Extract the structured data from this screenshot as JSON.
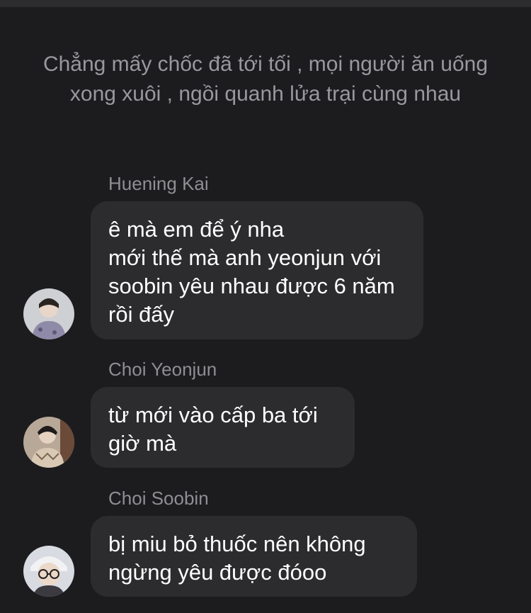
{
  "narration": "Chẳng mấy chốc đã tới tối , mọi người ăn uống xong xuôi , ngồi quanh lửa trại cùng nhau",
  "messages": [
    {
      "sender": "Huening Kai",
      "text": "ê mà em để ý nha\nmới thế mà anh yeonjun với soobin yêu nhau được 6 năm rồi đấy",
      "avatar_icon": "user-avatar-photo"
    },
    {
      "sender": "Choi Yeonjun",
      "text": "từ mới vào cấp ba tới giờ mà",
      "avatar_icon": "user-avatar-photo"
    },
    {
      "sender": "Choi Soobin",
      "text": "bị miu bỏ thuốc nên không ngừng yêu được đóoo",
      "avatar_icon": "user-avatar-photo"
    }
  ],
  "colors": {
    "background": "#1c1c1e",
    "bubble": "#2c2c2e",
    "message_text": "#ffffff",
    "sender_text": "#8e8e93",
    "narration_text": "#98989f"
  }
}
